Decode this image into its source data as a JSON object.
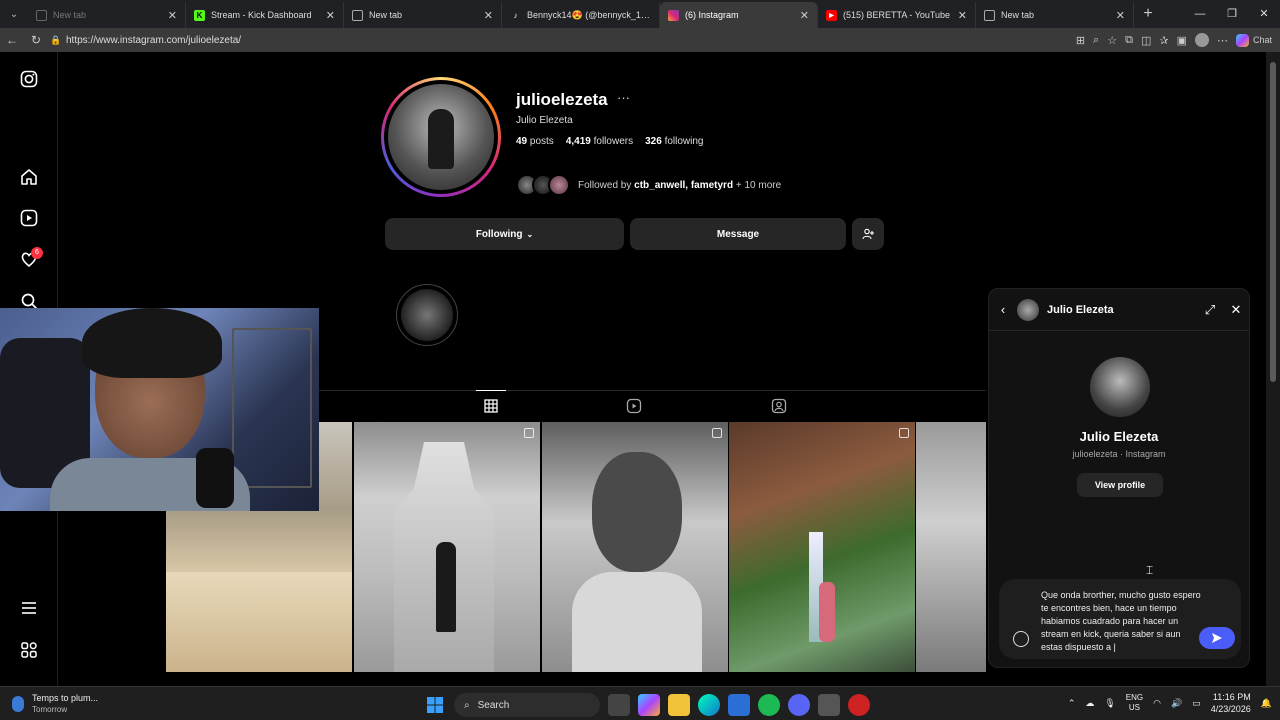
{
  "browser": {
    "tabs": [
      {
        "title": "New tab",
        "active": false,
        "dim": true
      },
      {
        "title": "Stream - Kick Dashboard",
        "active": false,
        "dim": false
      },
      {
        "title": "New tab",
        "active": false,
        "dim": false
      },
      {
        "title": "Bennyck14😍 (@bennyck_14) | Ti",
        "active": false,
        "dim": false
      },
      {
        "title": "(6) Instagram",
        "active": true,
        "dim": false
      },
      {
        "title": "(515) BERETTA - YouTube",
        "active": false,
        "dim": false
      },
      {
        "title": "New tab",
        "active": false,
        "dim": false
      }
    ],
    "url": "https://www.instagram.com/julioelezeta/",
    "copilot_label": "Chat"
  },
  "sidenav": {
    "notifications_badge": "6"
  },
  "profile": {
    "username": "julioelezeta",
    "more": "···",
    "full_name": "Julio Elezeta",
    "posts_count": "49",
    "posts_label": "posts",
    "followers_count": "4,419",
    "followers_label": "followers",
    "following_count": "326",
    "following_label": "following",
    "followed_by_prefix": "Followed by ",
    "followed_by_names": "ctb_anwell, fametyrd",
    "followed_by_more": " + 10 more",
    "following_button": "Following",
    "message_button": "Message"
  },
  "chat": {
    "header_name": "Julio Elezeta",
    "name": "Julio Elezeta",
    "subtitle": "julioelezeta · Instagram",
    "view_profile": "View profile",
    "draft_message": "Que onda brorther, mucho gusto espero te encontres bien, hace un tiempo habiamos cuadrado para hacer un stream en kick, queria saber si aun estas dispuesto a |"
  },
  "taskbar": {
    "weather_title": "Temps to plum...",
    "weather_sub": "Tomorrow",
    "search_label": "Search",
    "lang_top": "ENG",
    "lang_bottom": "US",
    "time": "11:16 PM",
    "date": "4/23/2026"
  }
}
